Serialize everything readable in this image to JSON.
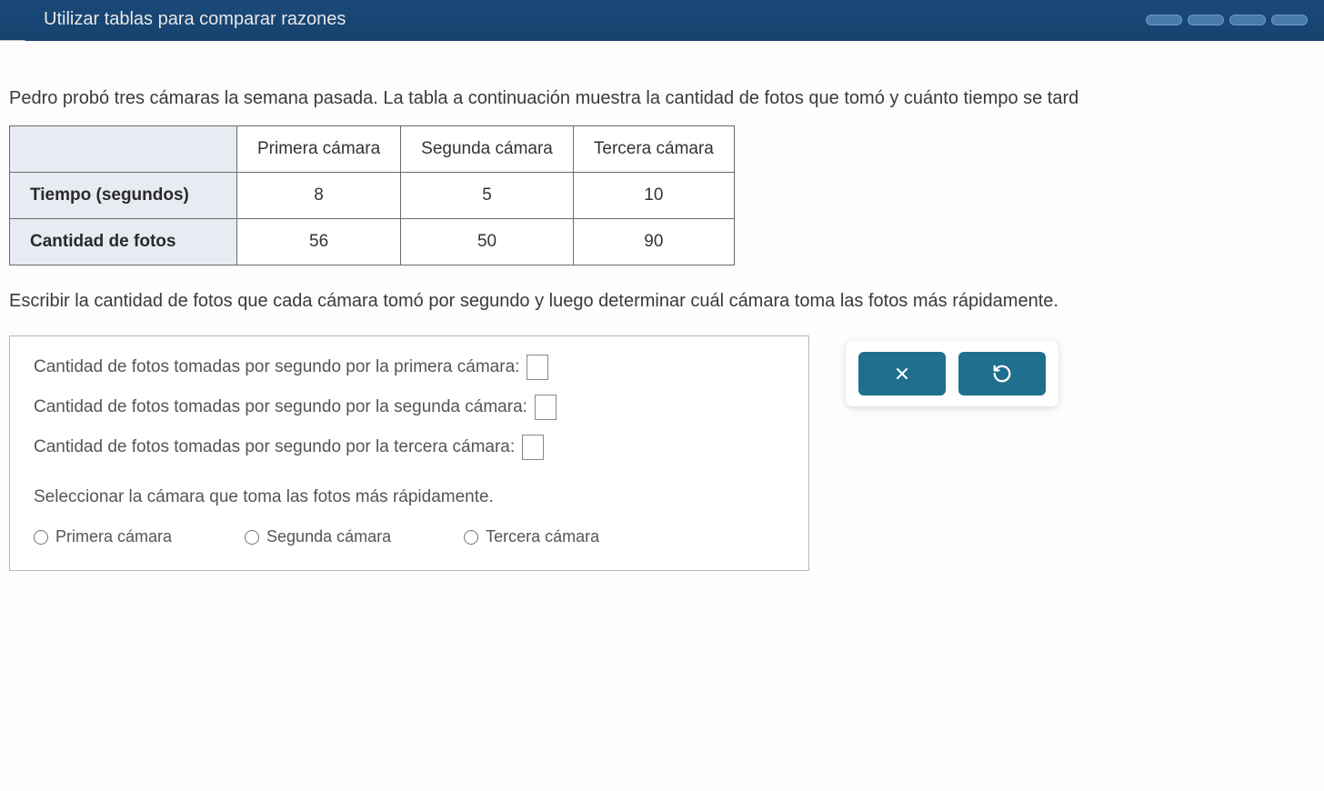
{
  "header": {
    "title": "Utilizar tablas para comparar razones"
  },
  "intro": "Pedro probó tres cámaras la semana pasada. La tabla a continuación muestra la cantidad de fotos que tomó y cuánto tiempo se tard",
  "table": {
    "col_headers": [
      "Primera cámara",
      "Segunda cámara",
      "Tercera cámara"
    ],
    "rows": [
      {
        "label": "Tiempo (segundos)",
        "values": [
          "8",
          "5",
          "10"
        ]
      },
      {
        "label": "Cantidad de fotos",
        "values": [
          "56",
          "50",
          "90"
        ]
      }
    ]
  },
  "instruction": "Escribir la cantidad de fotos que cada cámara tomó por segundo y luego determinar cuál cámara toma las fotos más rápidamente.",
  "answers": {
    "line1": "Cantidad de fotos tomadas por segundo por la primera cámara:",
    "line2": "Cantidad de fotos tomadas por segundo por la segunda cámara:",
    "line3": "Cantidad de fotos tomadas por segundo por la tercera cámara:",
    "val1": "",
    "val2": "",
    "val3": ""
  },
  "select_prompt": "Seleccionar la cámara que toma las fotos más rápidamente.",
  "options": {
    "opt1": "Primera cámara",
    "opt2": "Segunda cámara",
    "opt3": "Tercera cámara"
  },
  "buttons": {
    "clear": "×",
    "reset": "↺"
  },
  "chart_data": {
    "type": "table",
    "columns": [
      "",
      "Primera cámara",
      "Segunda cámara",
      "Tercera cámara"
    ],
    "rows": [
      [
        "Tiempo (segundos)",
        8,
        5,
        10
      ],
      [
        "Cantidad de fotos",
        56,
        50,
        90
      ]
    ]
  }
}
